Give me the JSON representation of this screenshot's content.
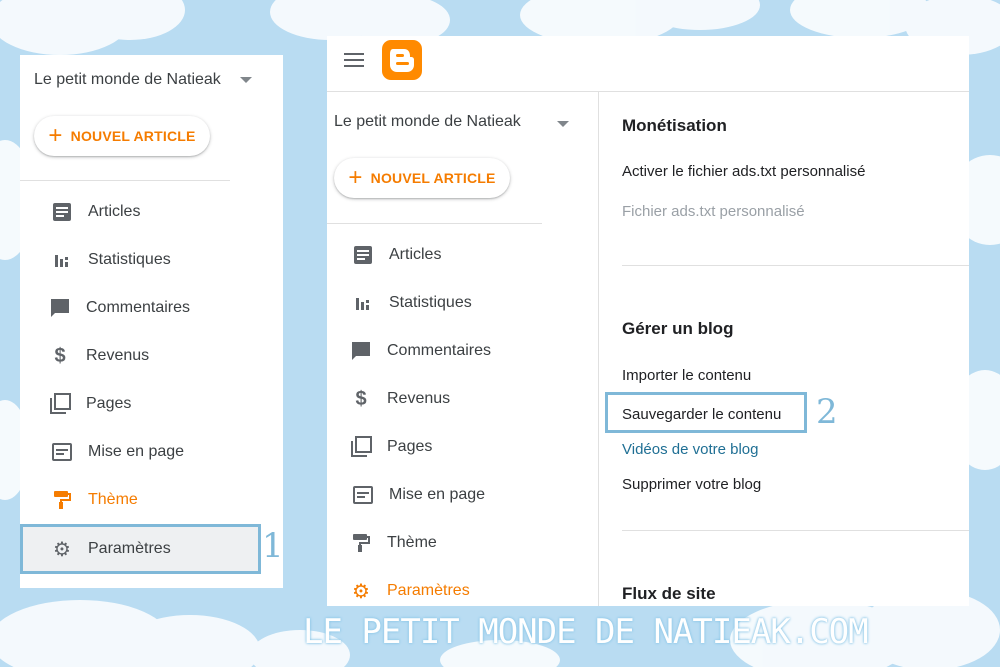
{
  "blog_name": "Le petit monde de Natieak",
  "new_article_label": "NOUVEL ARTICLE",
  "nav": [
    {
      "label": "Articles",
      "icon": "article-icon"
    },
    {
      "label": "Statistiques",
      "icon": "stats-icon"
    },
    {
      "label": "Commentaires",
      "icon": "comment-icon"
    },
    {
      "label": "Revenus",
      "icon": "dollar-icon"
    },
    {
      "label": "Pages",
      "icon": "pages-icon"
    },
    {
      "label": "Mise en page",
      "icon": "layout-icon"
    },
    {
      "label": "Thème",
      "icon": "paint-roller-icon"
    },
    {
      "label": "Paramètres",
      "icon": "gear-icon"
    }
  ],
  "annotations": {
    "step1": "1",
    "step2": "2"
  },
  "settings": {
    "monetisation": {
      "title": "Monétisation",
      "activate_ads": "Activer le fichier ads.txt personnalisé",
      "custom_ads": "Fichier ads.txt personnalisé"
    },
    "manage": {
      "title": "Gérer un blog",
      "import": "Importer le contenu",
      "backup": "Sauvegarder le contenu",
      "videos": "Vidéos de votre blog",
      "delete": "Supprimer votre blog"
    },
    "feed": {
      "title": "Flux de site"
    }
  },
  "footer_brand": "LE PETIT MONDE DE NATIEAK.COM",
  "colors": {
    "accent": "#f57c00",
    "highlight": "#7fb8d8",
    "link": "#1f6f94",
    "background": "#b9dcf2"
  }
}
